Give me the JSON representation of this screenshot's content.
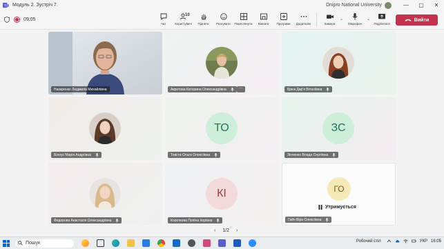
{
  "window": {
    "title": "Модуль 2. Зустріч 7.",
    "org": "Dnipro National University",
    "controls": [
      "—",
      "▢",
      "✕"
    ]
  },
  "meeting": {
    "timer": "09:05",
    "tools": [
      {
        "label": "Чат",
        "icon": "chat-icon"
      },
      {
        "label": "Користувачі",
        "icon": "people-icon",
        "count": "10"
      },
      {
        "label": "Підняти",
        "icon": "raise-hand-icon"
      },
      {
        "label": "Реагувати",
        "icon": "react-icon"
      },
      {
        "label": "Переглянути",
        "icon": "view-icon"
      },
      {
        "label": "Кімнати",
        "icon": "rooms-icon"
      },
      {
        "label": "Програми",
        "icon": "apps-icon"
      },
      {
        "label": "Додатково",
        "icon": "more-icon"
      }
    ],
    "camera_label": "Камера",
    "mic_label": "Мікрофон",
    "share_label": "Поділитися",
    "leave_label": "Вийти"
  },
  "participants": [
    {
      "name": "Назаренко Людмила Михайлівна",
      "type": "video"
    },
    {
      "name": "Акритова Катерина Олександрівна",
      "type": "photo",
      "more": "···"
    },
    {
      "name": "Брюк Дар'я Віталіївна",
      "type": "photo"
    },
    {
      "name": "Білоус Марія Андріївна",
      "type": "photo"
    },
    {
      "name": "Товста Ольга Олексіївна",
      "type": "initials",
      "initials": "ТО",
      "color": "#1e7a4a",
      "bg": "#cdeed8"
    },
    {
      "name": "Зінченко Влада Сергіївна",
      "type": "initials",
      "initials": "ЗС",
      "color": "#1e7a4a",
      "bg": "#cdeed8"
    },
    {
      "name": "Федорова Анастасія Олександрівна",
      "type": "photo"
    },
    {
      "name": "Короткова Поліна Ігорівна",
      "type": "initials",
      "initials": "КІ",
      "color": "#9b3a3a",
      "bg": "#f3dada"
    },
    {
      "name": "Гайч Віра Олексіївна",
      "type": "initials",
      "initials": "ГО",
      "color": "#7a5a10",
      "bg": "#f6e9b8",
      "status": "Утримується"
    }
  ],
  "pager": {
    "label": "1/2",
    "prev": "‹",
    "next": "›"
  },
  "taskbar": {
    "search_placeholder": "Пошук",
    "desktop_label": "Робочий стіл",
    "lang": "УКР",
    "time": "16:05"
  }
}
